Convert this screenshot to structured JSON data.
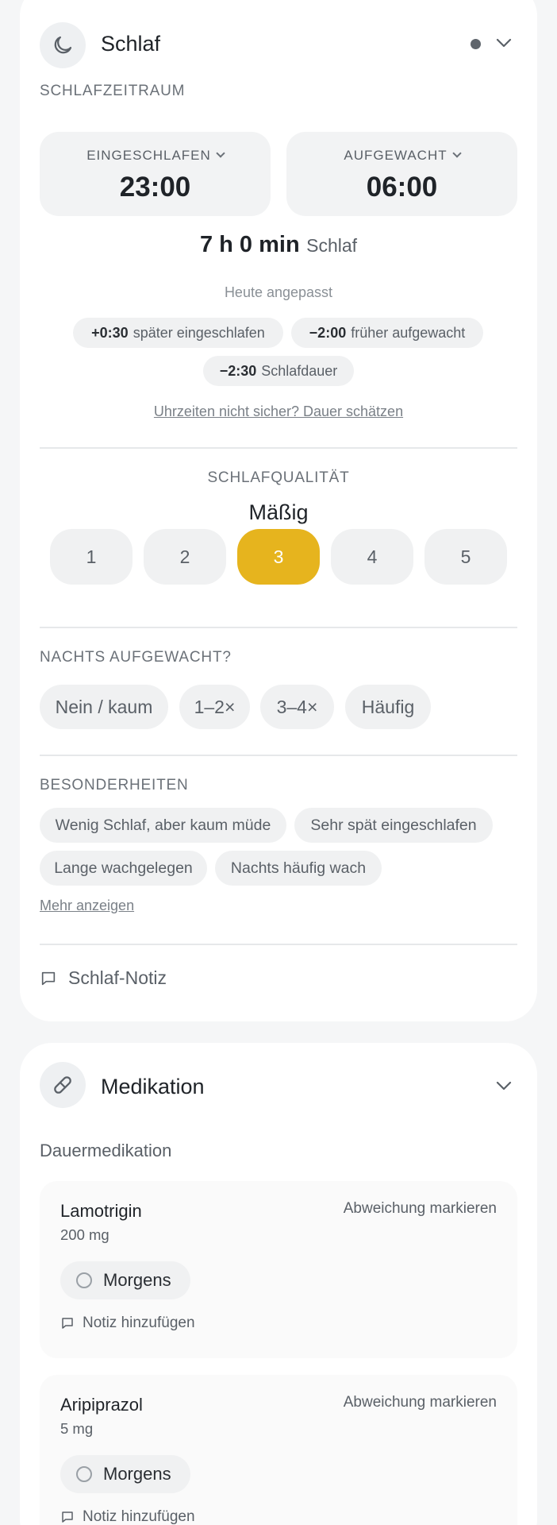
{
  "sleep": {
    "title": "Schlaf",
    "section_label": "SCHLAFZEITRAUM",
    "asleep": {
      "label": "EINGESCHLAFEN",
      "value": "23:00"
    },
    "awake": {
      "label": "AUFGEWACHT",
      "value": "06:00"
    },
    "duration": {
      "value": "7 h 0 min",
      "unit": "Schlaf"
    },
    "adjusted_label": "Heute angepasst",
    "adjustments": [
      {
        "delta": "+0:30",
        "text": "später eingeschlafen"
      },
      {
        "delta": "−2:00",
        "text": "früher aufgewacht"
      },
      {
        "delta": "−2:30",
        "text": "Schlafdauer"
      }
    ],
    "estimate_link": "Uhrzeiten nicht sicher? Dauer schätzen",
    "quality": {
      "label": "SCHLAFQUALITÄT",
      "value_label": "Mäßig",
      "options": [
        "1",
        "2",
        "3",
        "4",
        "5"
      ],
      "selected": 3,
      "selected_color": "#e6b41e"
    },
    "woke_up": {
      "label": "NACHTS AUFGEWACHT?",
      "options": [
        "Nein / kaum",
        "1–2×",
        "3–4×",
        "Häufig"
      ]
    },
    "specifics": {
      "label": "BESONDERHEITEN",
      "tags": [
        "Wenig Schlaf, aber kaum müde",
        "Sehr spät eingeschlafen",
        "Lange wachgelegen",
        "Nachts häufig wach"
      ],
      "more_link": "Mehr anzeigen"
    },
    "note_label": "Schlaf-Notiz"
  },
  "medication": {
    "title": "Medikation",
    "section_label": "Dauermedikation",
    "items": [
      {
        "name": "Lamotrigin",
        "dose": "200 mg",
        "deviation": "Abweichung markieren",
        "intake": "Morgens",
        "note": "Notiz hinzufügen"
      },
      {
        "name": "Aripiprazol",
        "dose": "5 mg",
        "deviation": "Abweichung markieren",
        "intake": "Morgens",
        "note": "Notiz hinzufügen"
      }
    ]
  }
}
